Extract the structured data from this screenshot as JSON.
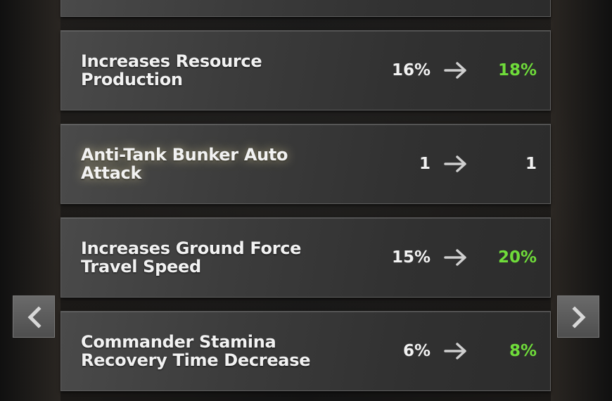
{
  "colors": {
    "increase": "#6fdc3a",
    "text": "#f2f2f2"
  },
  "icons": {
    "arrow": "right-arrow-icon",
    "prev": "chevron-left-icon",
    "next": "chevron-right-icon"
  },
  "upgrades": [
    {
      "label": "Increases Resource Production",
      "from": "16%",
      "to": "18%",
      "increased": true
    },
    {
      "label": "Anti-Tank Bunker Auto Attack",
      "from": "1",
      "to": "1",
      "increased": false
    },
    {
      "label": "Increases Ground Force Travel Speed",
      "from": "15%",
      "to": "20%",
      "increased": true
    },
    {
      "label": "Commander Stamina Recovery Time Decrease",
      "from": "6%",
      "to": "8%",
      "increased": true
    }
  ]
}
